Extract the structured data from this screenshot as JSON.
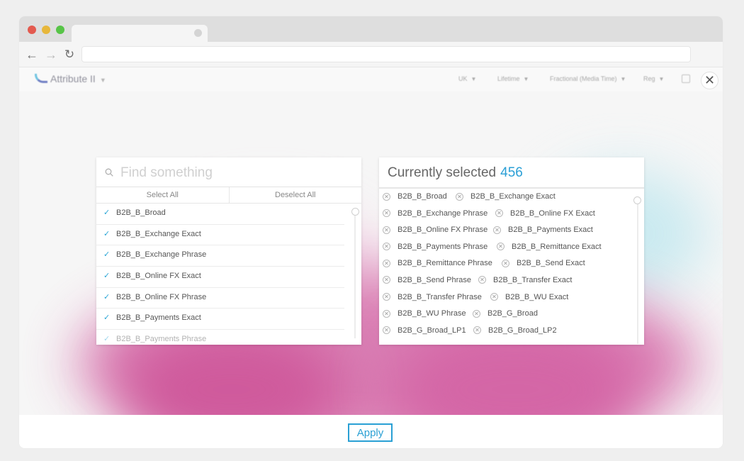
{
  "browser": {
    "back_icon": "arrow-left-icon",
    "forward_icon": "arrow-right-icon",
    "reload_icon": "reload-icon"
  },
  "app_header": {
    "logo_text": "Attribute II",
    "filters": [
      "UK",
      "Lifetime",
      "Fractional (Media Time)",
      "Reg"
    ]
  },
  "search": {
    "placeholder": "Find something",
    "select_all": "Select All",
    "deselect_all": "Deselect All"
  },
  "left_list": {
    "items": [
      {
        "label": "B2B_B_Broad",
        "checked": true
      },
      {
        "label": "B2B_B_Exchange Exact",
        "checked": true
      },
      {
        "label": "B2B_B_Exchange Phrase",
        "checked": true
      },
      {
        "label": "B2B_B_Online FX Exact",
        "checked": true
      },
      {
        "label": "B2B_B_Online FX Phrase",
        "checked": true
      },
      {
        "label": "B2B_B_Payments Exact",
        "checked": true
      },
      {
        "label": "B2B_B_Payments Phrase",
        "checked": true
      }
    ]
  },
  "selected": {
    "title": "Currently selected",
    "count": "456",
    "rows": [
      [
        "B2B_B_Broad",
        "B2B_B_Exchange Exact"
      ],
      [
        "B2B_B_Exchange Phrase",
        "B2B_B_Online FX Exact"
      ],
      [
        "B2B_B_Online FX Phrase",
        "B2B_B_Payments Exact"
      ],
      [
        "B2B_B_Payments Phrase",
        "B2B_B_Remittance Exact"
      ],
      [
        "B2B_B_Remittance Phrase",
        "B2B_B_Send Exact"
      ],
      [
        "B2B_B_Send Phrase",
        "B2B_B_Transfer Exact"
      ],
      [
        "B2B_B_Transfer Phrase",
        "B2B_B_WU Exact"
      ],
      [
        "B2B_B_WU Phrase",
        "B2B_G_Broad"
      ],
      [
        "B2B_G_Broad_LP1",
        "B2B_G_Broad_LP2"
      ]
    ]
  },
  "footer": {
    "apply_label": "Apply"
  },
  "colors": {
    "accent": "#2aa0d4",
    "background_magenta": "#d466a6"
  }
}
